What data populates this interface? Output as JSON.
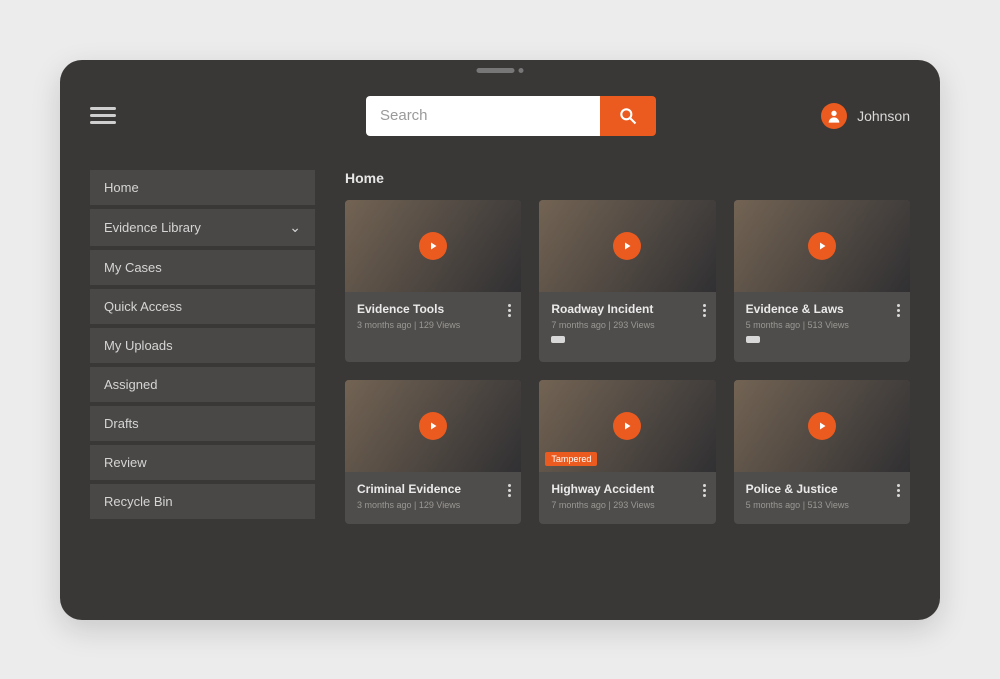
{
  "search": {
    "placeholder": "Search"
  },
  "user": {
    "name": "Johnson"
  },
  "page_title": "Home",
  "sidebar": {
    "items": [
      {
        "label": "Home",
        "expandable": false
      },
      {
        "label": "Evidence Library",
        "expandable": true
      },
      {
        "label": "My Cases",
        "expandable": false
      },
      {
        "label": "Quick Access",
        "expandable": false
      },
      {
        "label": "My Uploads",
        "expandable": false
      },
      {
        "label": "Assigned",
        "expandable": false
      },
      {
        "label": "Drafts",
        "expandable": false
      },
      {
        "label": "Review",
        "expandable": false
      },
      {
        "label": "Recycle Bin",
        "expandable": false
      }
    ]
  },
  "cards": [
    {
      "title": "Evidence Tools",
      "age": "3 months ago",
      "views": "129 Views",
      "tag": null,
      "pill": false
    },
    {
      "title": "Roadway Incident",
      "age": "7 months ago",
      "views": "293 Views",
      "tag": null,
      "pill": true
    },
    {
      "title": "Evidence & Laws",
      "age": "5 months ago",
      "views": "513 Views",
      "tag": null,
      "pill": true
    },
    {
      "title": "Criminal Evidence",
      "age": "3 months ago",
      "views": "129 Views",
      "tag": null,
      "pill": false
    },
    {
      "title": "Highway Accident",
      "age": "7 months ago",
      "views": "293 Views",
      "tag": "Tampered",
      "pill": false
    },
    {
      "title": "Police & Justice",
      "age": "5 months ago",
      "views": "513 Views",
      "tag": null,
      "pill": false
    }
  ],
  "colors": {
    "accent": "#eb5a1f"
  }
}
